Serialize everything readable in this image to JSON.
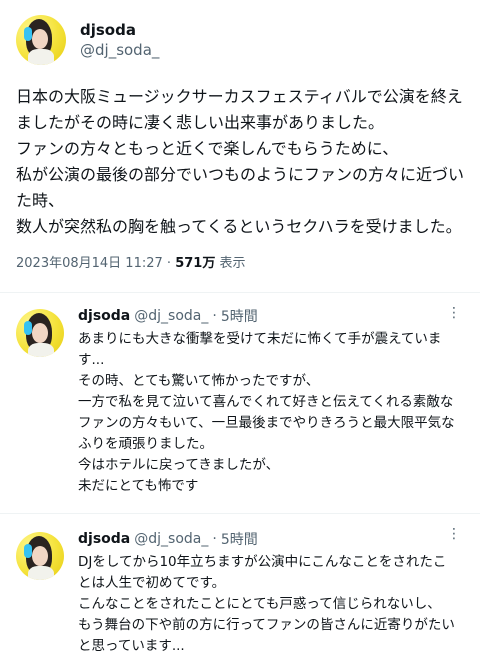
{
  "main_tweet": {
    "display_name": "djsoda",
    "handle": "@dj_soda_",
    "text": "日本の大阪ミュージックサーカスフェスティバルで公演を終えましたがその時に凄く悲しい出来事がありました。\nファンの方々ともっと近くで楽しんでもらうために、\n私が公演の最後の部分でいつものようにファンの方々に近づいた時、\n数人が突然私の胸を触ってくるというセクハラを受けました。",
    "date": "2023年08月14日 11:27",
    "separator": "·",
    "views_count": "571万",
    "views_label": "表示"
  },
  "replies": [
    {
      "display_name": "djsoda",
      "handle": "@dj_soda_",
      "dot": "·",
      "time": "5時間",
      "more": "⋮",
      "text": "あまりにも大きな衝撃を受けて未だに怖くて手が震えています...\nその時、とても驚いて怖かったですが、\n一方で私を見て泣いて喜んでくれて好きと伝えてくれる素敵なファンの方々もいて、一旦最後までやりきろうと最大限平気なふりを頑張りました。\n今はホテルに戻ってきましたが、\n未だにとても怖です"
    },
    {
      "display_name": "djsoda",
      "handle": "@dj_soda_",
      "dot": "·",
      "time": "5時間",
      "more": "⋮",
      "text": "DJをしてから10年立ちますが公演中にこんなことをされたことは人生で初めてです。\nこんなことをされたことにとても戸惑って信じられないし、\nもう舞台の下や前の方に行ってファンの皆さんに近寄りがたいと思っています..."
    }
  ]
}
